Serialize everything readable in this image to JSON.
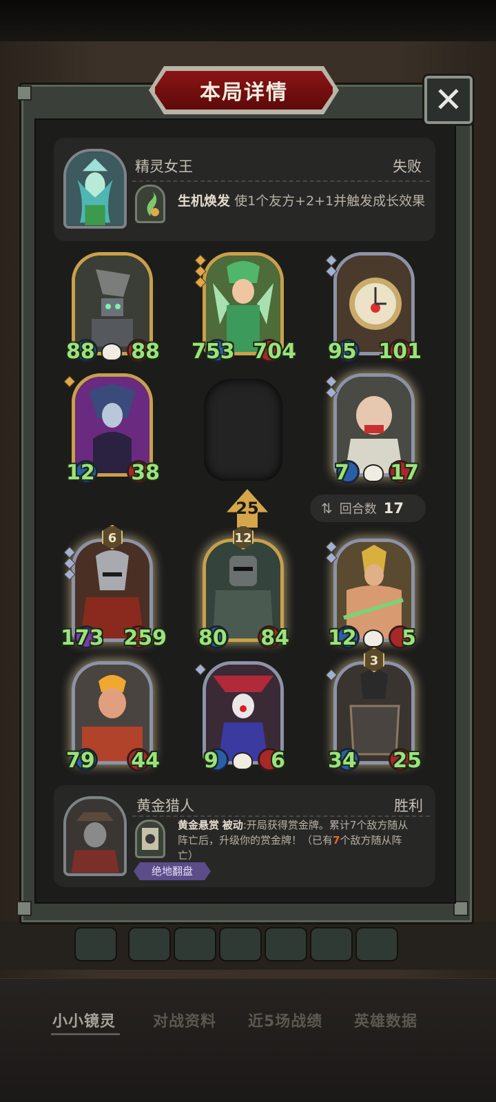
{
  "title": "本局详情",
  "close_label": "✕",
  "opponent": {
    "hero_name": "精灵女王",
    "result": "失败",
    "skill_name": "生机焕发",
    "skill_text": "使1个友方+2+1并触发成长效果"
  },
  "minions": [
    {
      "attack": "88",
      "health": "88"
    },
    {
      "attack": "753",
      "health": "704"
    },
    {
      "attack": "95",
      "health": "101"
    },
    {
      "attack": "12",
      "health": "38"
    },
    {
      "attack": "7",
      "health": "17"
    },
    {
      "attack": "173",
      "health": "259",
      "level": "6"
    },
    {
      "attack": "80",
      "health": "84",
      "level": "12"
    },
    {
      "attack": "12",
      "health": "5"
    },
    {
      "attack": "79",
      "health": "44"
    },
    {
      "attack": "9",
      "health": "6"
    },
    {
      "attack": "34",
      "health": "25",
      "level": "3"
    }
  ],
  "arrow_value": "25",
  "round": {
    "label": "回合数",
    "value": "17"
  },
  "player": {
    "hero_name": "黄金猎人",
    "result": "胜利",
    "skill_name": "黄金悬赏",
    "skill_type": "被动",
    "skill_text_1": ":开局获得赏金牌。累计7个敌方随从",
    "skill_text_2": "阵亡后，升级你的赏金牌！（已有",
    "skill_count": "7",
    "skill_text_3": "个敌方随从阵",
    "skill_text_4": "亡）",
    "tag": "绝地翻盘"
  },
  "nav": {
    "tabs": [
      "小小镜灵",
      "对战资料",
      "近5场战绩",
      "英雄数据"
    ],
    "active": 0
  }
}
